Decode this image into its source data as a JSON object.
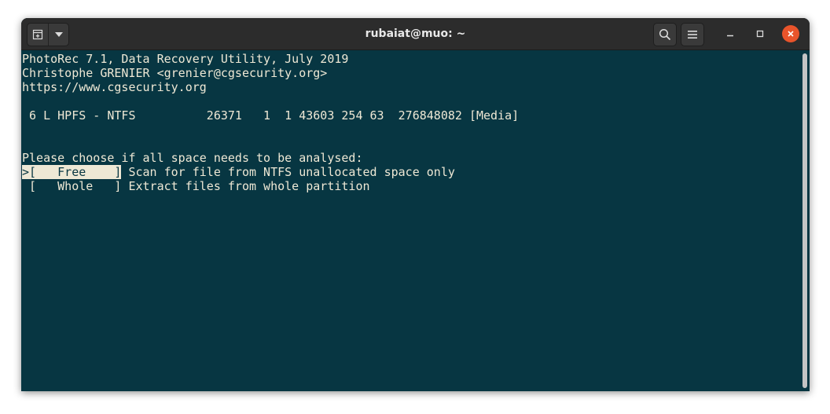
{
  "window": {
    "title": "rubaiat@muo: ~"
  },
  "terminal": {
    "lines": [
      "PhotoRec 7.1, Data Recovery Utility, July 2019",
      "Christophe GRENIER <grenier@cgsecurity.org>",
      "https://www.cgsecurity.org",
      " 6 L HPFS - NTFS          26371   1  1 43603 254 63  276848082 [Media]",
      "Please choose if all space needs to be analysed:"
    ],
    "options": [
      {
        "selector": ">",
        "label": "[   Free    ]",
        "description": " Scan for file from NTFS unallocated space only"
      },
      {
        "selector": " ",
        "label": "[   Whole   ]",
        "description": " Extract files from whole partition"
      }
    ]
  },
  "icons": {
    "new_tab": "new-tab-icon",
    "menu_dropdown": "chevron-down-icon",
    "search": "search-icon",
    "hamburger": "hamburger-menu-icon",
    "minimize": "minimize-icon",
    "maximize": "maximize-icon",
    "close": "close-icon"
  },
  "colors": {
    "terminal_bg": "#073642",
    "terminal_fg": "#eee8d5",
    "titlebar_bg": "#2c2c2c",
    "close_btn": "#e9542b"
  }
}
